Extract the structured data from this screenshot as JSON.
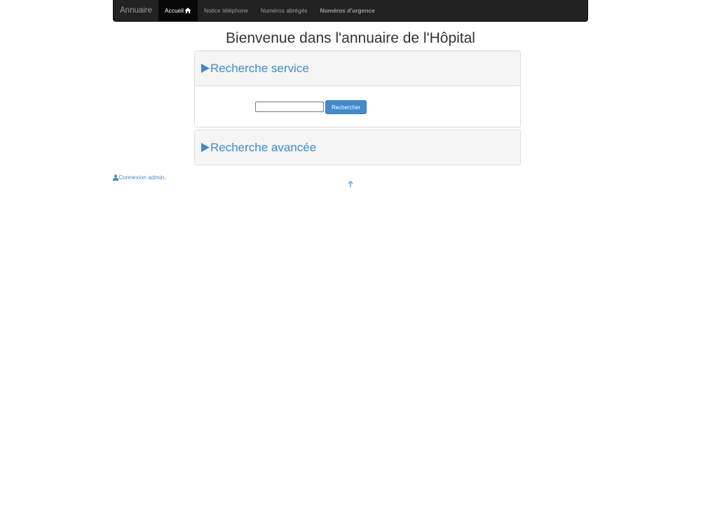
{
  "navbar": {
    "brand": "Annuaire",
    "items": [
      {
        "label": "Accueil",
        "active": true,
        "icon": "home-icon"
      },
      {
        "label": "Notice téléphone",
        "active": false
      },
      {
        "label": "Numéros abrégés",
        "active": false
      },
      {
        "label": "Numéros d'urgence",
        "active": false,
        "bold": true
      }
    ]
  },
  "page": {
    "title": "Bienvenue dans l'annuaire de l'Hôpital"
  },
  "panels": {
    "service": {
      "title": "Recherche service",
      "icon": "triangle-right-icon",
      "search_value": "",
      "search_placeholder": "",
      "button_label": "Rechercher"
    },
    "advanced": {
      "title": "Recherche avancée",
      "icon": "triangle-right-icon"
    }
  },
  "footer": {
    "admin_link": "Connexion admin.",
    "admin_icon": "user-icon",
    "scroll_top_icon": "arrow-up-icon"
  },
  "colors": {
    "navbar_bg": "#222222",
    "navbar_active_bg": "#080808",
    "nav_text": "#9d9d9d",
    "accent": "#428bca",
    "panel_heading_bg": "#f5f5f5"
  }
}
